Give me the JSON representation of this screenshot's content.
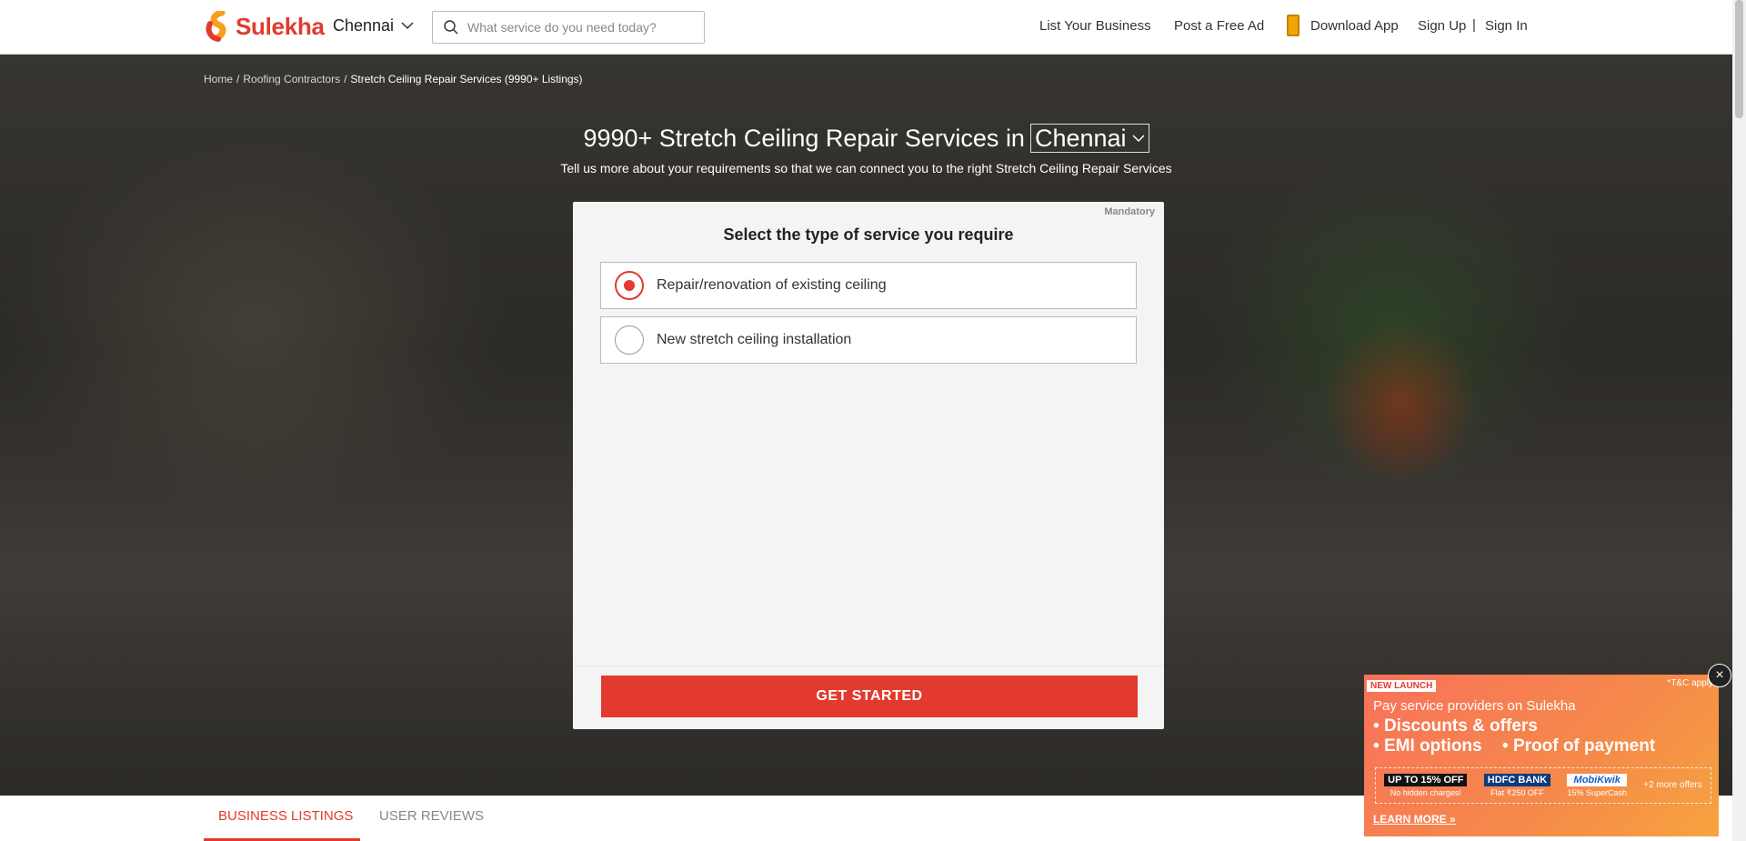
{
  "header": {
    "logo_text": "Sulekha",
    "city": "Chennai",
    "search_placeholder": "What service do you need today?",
    "nav": {
      "list_business": "List Your Business",
      "post_ad": "Post a Free Ad",
      "download_app": "Download App",
      "sign_up": "Sign Up",
      "separator": "|",
      "sign_in": "Sign In"
    }
  },
  "breadcrumb": {
    "home": "Home",
    "category": "Roofing Contractors",
    "current": "Stretch Ceiling Repair Services (9990+ Listings)",
    "sep": "/"
  },
  "hero": {
    "title": "9990+ Stretch Ceiling Repair Services in",
    "city": "Chennai",
    "subtitle": "Tell us more about your requirements so that we can connect you to the right Stretch Ceiling Repair Services"
  },
  "form": {
    "mandatory": "Mandatory",
    "question": "Select the type of service you require",
    "options": [
      {
        "label": "Repair/renovation of existing ceiling",
        "selected": true
      },
      {
        "label": "New stretch ceiling installation",
        "selected": false
      }
    ],
    "cta": "GET STARTED"
  },
  "tabs": [
    {
      "label": "BUSINESS LISTINGS",
      "active": true
    },
    {
      "label": "USER REVIEWS",
      "active": false
    }
  ],
  "promo": {
    "badge": "NEW LAUNCH",
    "tc": "*T&C apply",
    "heading": "Pay service providers on Sulekha",
    "bullets": [
      "Discounts & offers",
      "EMI options",
      "Proof of payment"
    ],
    "offers": [
      {
        "top": "UP TO 15% OFF",
        "bottom": "No hidden charges!"
      },
      {
        "top": "HDFC BANK",
        "bottom": "Flat ₹250 OFF"
      },
      {
        "top": "MobiKwik",
        "bottom": "15% SuperCash"
      }
    ],
    "more_offers": "+2 more offers",
    "learn_more": "LEARN MORE",
    "close": "×"
  },
  "colors": {
    "brand": "#e23a2e"
  }
}
